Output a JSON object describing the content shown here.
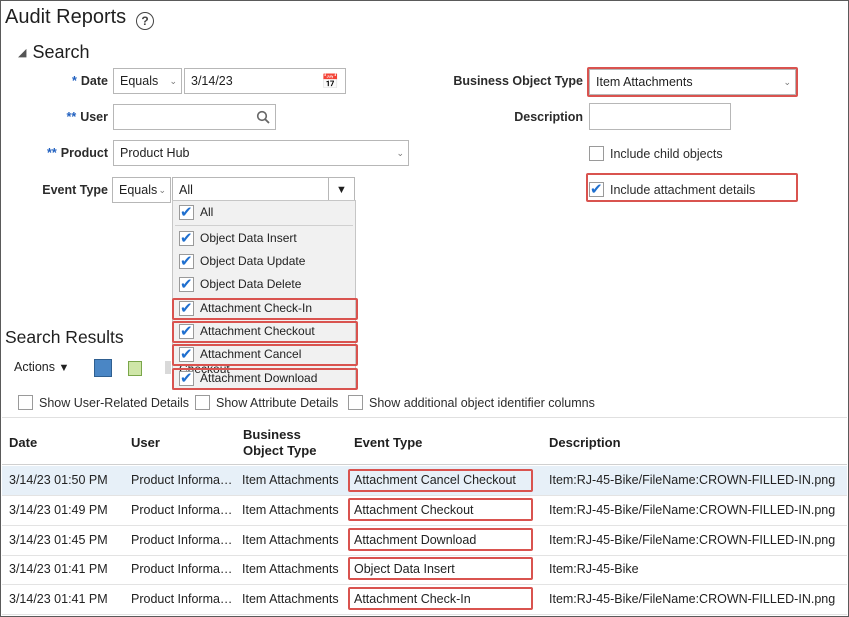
{
  "page": {
    "title": "Audit Reports"
  },
  "search": {
    "heading": "Search",
    "date": {
      "label": "Date",
      "required_mark": "*",
      "operator": "Equals",
      "value": "3/14/23"
    },
    "user": {
      "label": "User",
      "required_mark": "**",
      "value": ""
    },
    "product": {
      "label": "Product",
      "required_mark": "**",
      "value": "Product Hub"
    },
    "event_type": {
      "label": "Event Type",
      "operator": "Equals",
      "value": "All"
    },
    "business_object_type": {
      "label": "Business Object Type",
      "value": "Item Attachments"
    },
    "description": {
      "label": "Description",
      "value": ""
    },
    "include_child": {
      "label": "Include child objects",
      "checked": false
    },
    "include_attachment": {
      "label": "Include attachment details",
      "checked": true
    },
    "event_options": [
      {
        "label": "All",
        "checked": true
      },
      {
        "label": "Object Data Insert",
        "checked": true
      },
      {
        "label": "Object Data Update",
        "checked": true
      },
      {
        "label": "Object Data Delete",
        "checked": true
      },
      {
        "label": "Attachment Check-In",
        "checked": true
      },
      {
        "label": "Attachment Checkout",
        "checked": true
      },
      {
        "label": "Attachment Cancel Checkout",
        "checked": true
      },
      {
        "label": "Attachment Download",
        "checked": true
      }
    ]
  },
  "results": {
    "heading": "Search Results",
    "actions_label": "Actions",
    "filters": [
      "Show User-Related Details",
      "Show Attribute Details",
      "Show additional object identifier columns"
    ],
    "columns": [
      "Date",
      "User",
      "Business Object Type",
      "Event Type",
      "Description"
    ],
    "rows": [
      {
        "date": "3/14/23 01:50 PM",
        "user": "Product Informa…",
        "bot": "Item Attachments",
        "event": "Attachment Cancel Checkout",
        "desc": "Item:RJ-45-Bike/FileName:CROWN-FILLED-IN.png"
      },
      {
        "date": "3/14/23 01:49 PM",
        "user": "Product Informa…",
        "bot": "Item Attachments",
        "event": "Attachment Checkout",
        "desc": "Item:RJ-45-Bike/FileName:CROWN-FILLED-IN.png"
      },
      {
        "date": "3/14/23 01:45 PM",
        "user": "Product Informa…",
        "bot": "Item Attachments",
        "event": "Attachment Download",
        "desc": "Item:RJ-45-Bike/FileName:CROWN-FILLED-IN.png"
      },
      {
        "date": "3/14/23 01:41 PM",
        "user": "Product Informa…",
        "bot": "Item Attachments",
        "event": "Object Data Insert",
        "desc": "Item:RJ-45-Bike"
      },
      {
        "date": "3/14/23 01:41 PM",
        "user": "Product Informa…",
        "bot": "Item Attachments",
        "event": "Attachment Check-In",
        "desc": "Item:RJ-45-Bike/FileName:CROWN-FILLED-IN.png"
      }
    ]
  },
  "colors": {
    "highlight": "#d9534f",
    "checkbox": "#1f6fcf",
    "selected_row": "#e7f0f8"
  }
}
